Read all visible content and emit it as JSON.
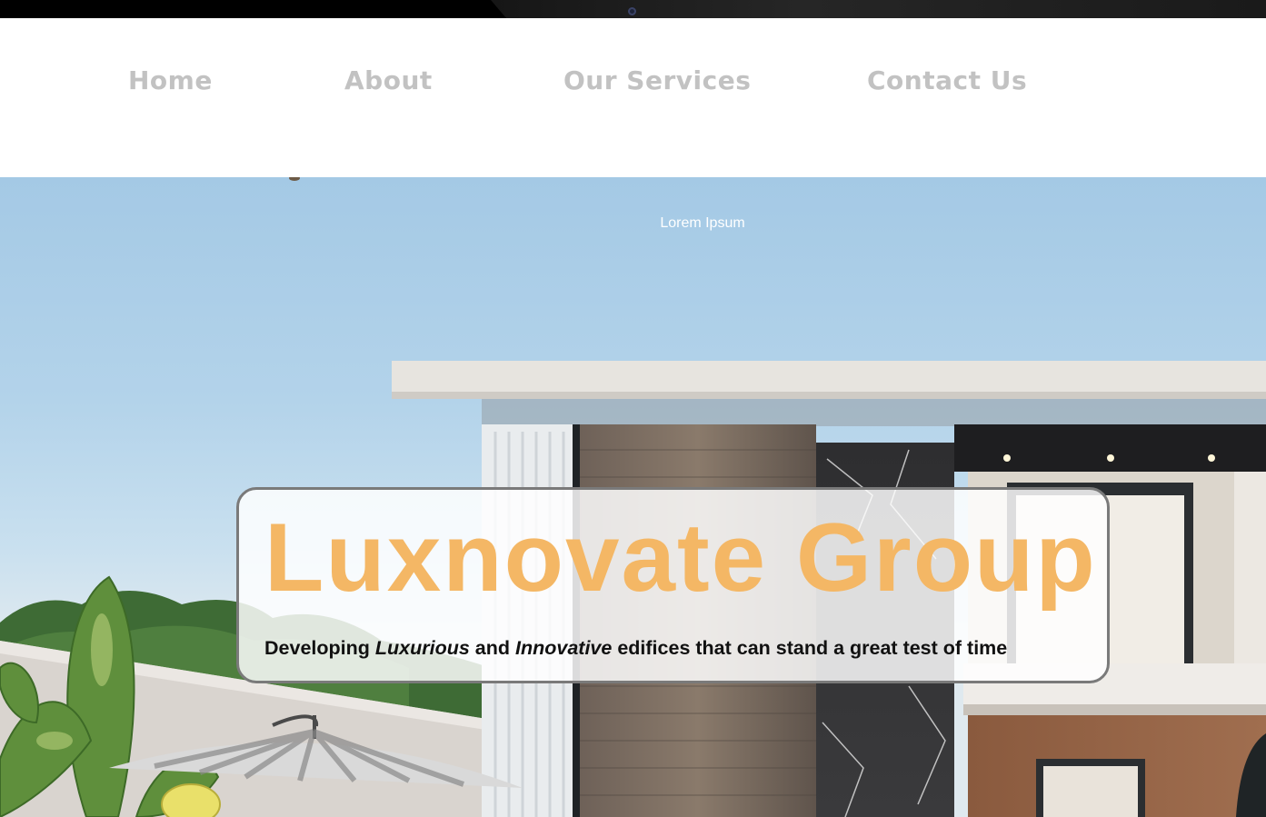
{
  "nav": {
    "items": [
      "Home",
      "About",
      "Our Services",
      "Contact Us"
    ]
  },
  "hero": {
    "kicker": "Lorem Ipsum",
    "title": "Luxnovate Group",
    "tagline": {
      "part1": "Developing",
      "em1": "Luxurious",
      "part2": "and",
      "em2": "Innovative",
      "part3": "edifices that can stand a great test of time"
    }
  },
  "colors": {
    "nav_text": "#c2c2c2",
    "title": "#f4b765",
    "sky": "#a4c9e5"
  },
  "icons": {
    "camera": "device-camera-icon"
  }
}
